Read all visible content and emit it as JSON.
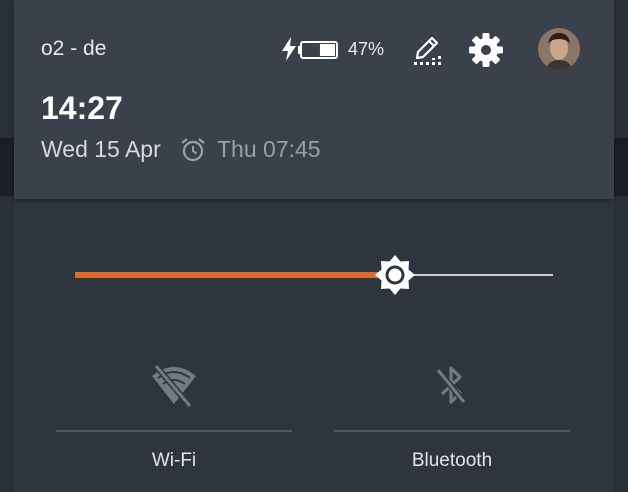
{
  "header": {
    "carrier": "o2 - de",
    "battery_percent": "47%",
    "battery_level": 0.47,
    "time": "14:27",
    "date": "Wed 15 Apr",
    "alarm_time": "Thu 07:45"
  },
  "brightness": {
    "level": 0.67,
    "accent_color": "#e0692e"
  },
  "tiles": [
    {
      "label": "Wi-Fi",
      "icon": "wifi-off-icon"
    },
    {
      "label": "Bluetooth",
      "icon": "bluetooth-off-icon"
    }
  ],
  "icons": {
    "charge": "charging-bolt-icon",
    "battery": "battery-icon",
    "edit": "edit-icon",
    "settings": "settings-gear-icon",
    "avatar": "user-avatar"
  }
}
